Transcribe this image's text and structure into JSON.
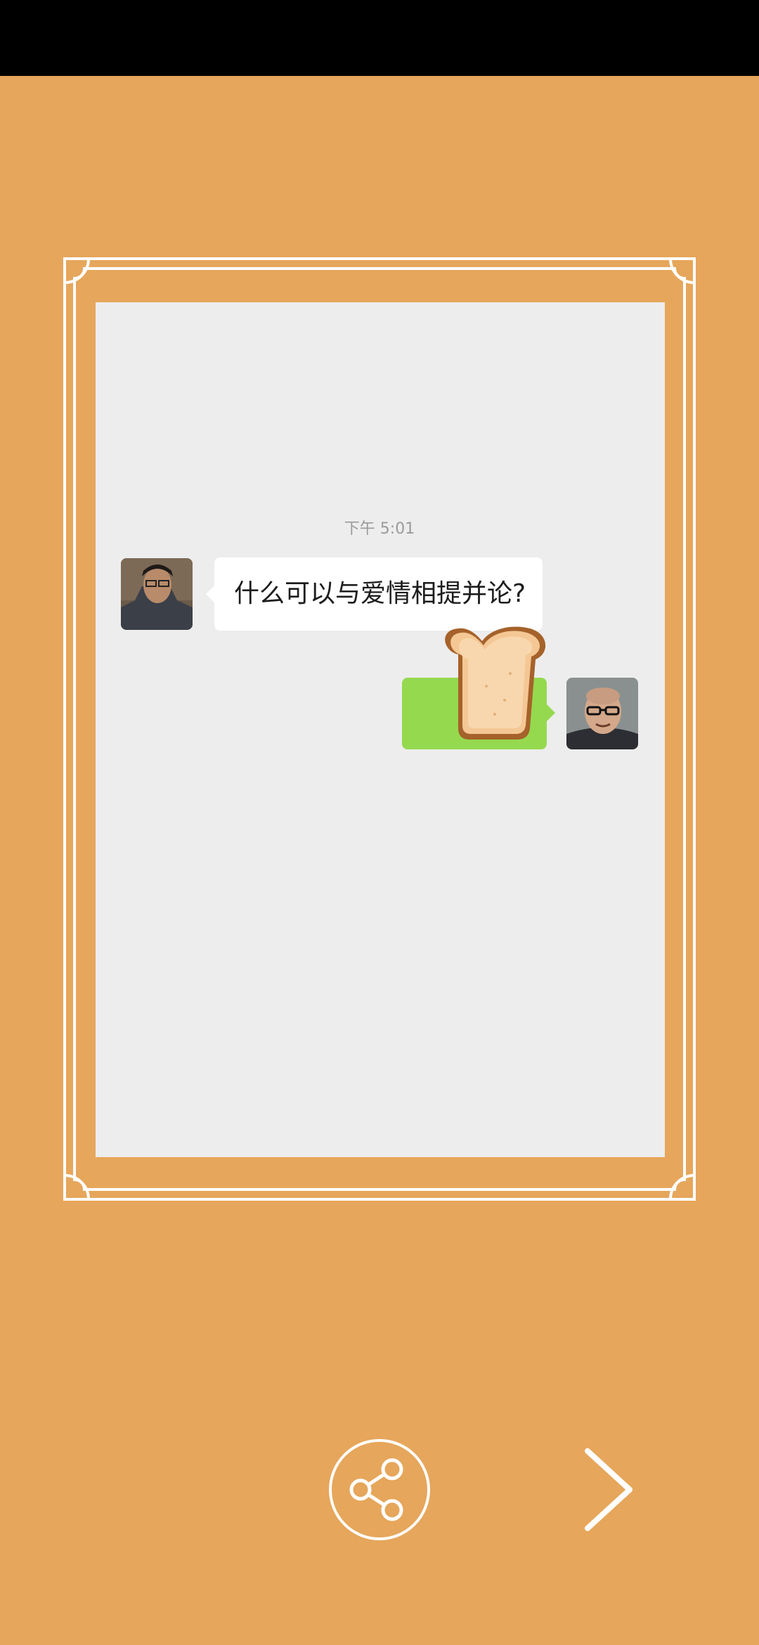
{
  "chat": {
    "timestamp": "下午 5:01",
    "messages": [
      {
        "sender": "left",
        "text": "什么可以与爱情相提并论?"
      },
      {
        "sender": "right",
        "text": ""
      }
    ]
  },
  "icons": {
    "share": "share-icon",
    "next": "chevron-right-icon",
    "toast": "toast-bread-icon"
  },
  "colors": {
    "background": "#E6A65B",
    "chat_background": "#EDEDED",
    "bubble_right": "#95D94F",
    "bubble_left": "#FFFFFF",
    "frame": "#FFFFFF"
  }
}
